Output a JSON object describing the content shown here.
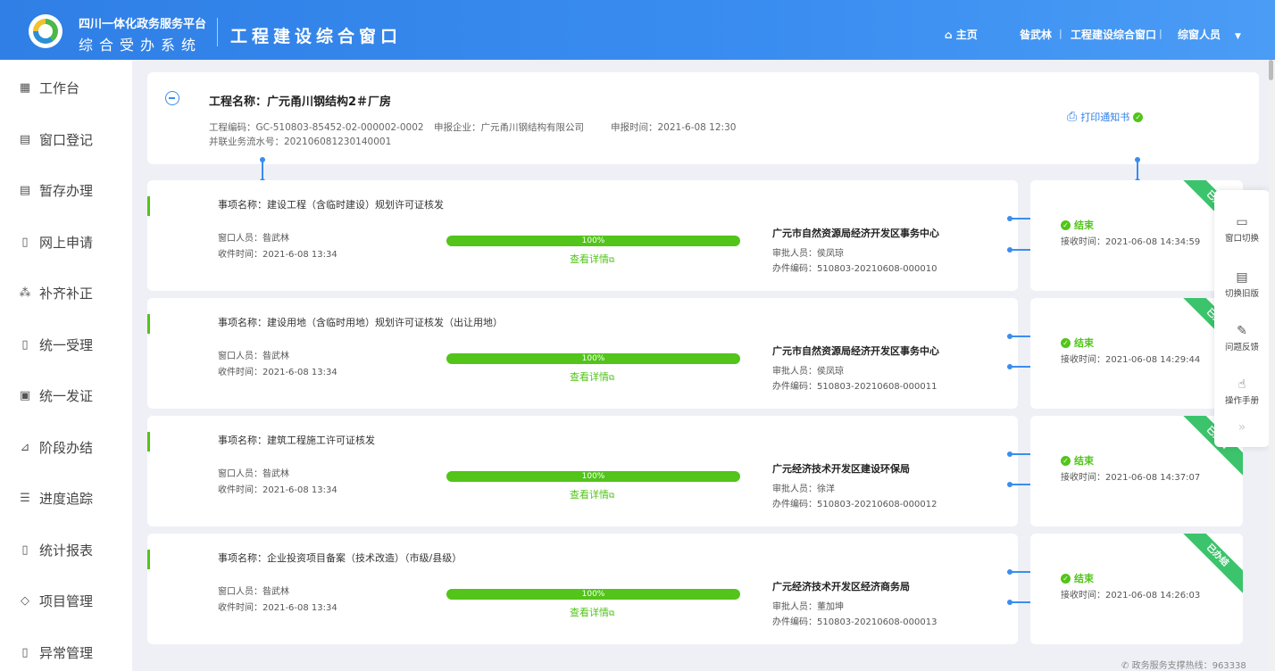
{
  "header": {
    "brand_top": "四川一体化政务服务平台",
    "brand_bottom": "综合受办系统",
    "app_title": "工程建设综合窗口",
    "nav": {
      "home": "主页",
      "user": "昝武林",
      "window": "工程建设综合窗口",
      "role": "综窗人员"
    }
  },
  "sidebar": {
    "items": [
      {
        "label": "工作台",
        "icon": "grid-icon"
      },
      {
        "label": "窗口登记",
        "icon": "document-icon"
      },
      {
        "label": "暂存办理",
        "icon": "document-icon"
      },
      {
        "label": "网上申请",
        "icon": "document-search-icon"
      },
      {
        "label": "补齐补正",
        "icon": "network-icon"
      },
      {
        "label": "统一受理",
        "icon": "document-search-icon"
      },
      {
        "label": "统一发证",
        "icon": "certificate-icon"
      },
      {
        "label": "阶段办结",
        "icon": "chart-line-icon"
      },
      {
        "label": "进度追踪",
        "icon": "list-icon"
      },
      {
        "label": "统计报表",
        "icon": "document-search-icon"
      },
      {
        "label": "项目管理",
        "icon": "shield-icon"
      },
      {
        "label": "异常管理",
        "icon": "document-search-icon"
      }
    ]
  },
  "project": {
    "title": "工程名称：广元甬川钢结构2＃厂房",
    "code": "工程编码：GC-510803-85452-02-000002-0002",
    "company": "申报企业：广元甬川钢结构有限公司",
    "time": "申报时间：2021-6-08 12:30",
    "serial": "并联业务流水号：202106081230140001",
    "print": "打印通知书"
  },
  "tasks": [
    {
      "name": "事项名称：建设工程（含临时建设）规划许可证核发",
      "staff": "窗口人员：昝武林",
      "received": "收件时间：2021-6-08 13:34",
      "progress": "100%",
      "detail": "查看详情",
      "org": "广元市自然资源局经济开发区事务中心",
      "approver": "审批人员：侯凤琼",
      "code": "办件编码：510803-20210608-000010",
      "status": "结束",
      "rtime": "接收时间：2021-06-08 14:34:59",
      "ribbon": "已办结"
    },
    {
      "name": "事项名称：建设用地（含临时用地）规划许可证核发（出让用地）",
      "staff": "窗口人员：昝武林",
      "received": "收件时间：2021-6-08 13:34",
      "progress": "100%",
      "detail": "查看详情",
      "org": "广元市自然资源局经济开发区事务中心",
      "approver": "审批人员：侯凤琼",
      "code": "办件编码：510803-20210608-000011",
      "status": "结束",
      "rtime": "接收时间：2021-06-08 14:29:44",
      "ribbon": "已办结"
    },
    {
      "name": "事项名称：建筑工程施工许可证核发",
      "staff": "窗口人员：昝武林",
      "received": "收件时间：2021-6-08 13:34",
      "progress": "100%",
      "detail": "查看详情",
      "org": "广元经济技术开发区建设环保局",
      "approver": "审批人员：徐洋",
      "code": "办件编码：510803-20210608-000012",
      "status": "结束",
      "rtime": "接收时间：2021-06-08 14:37:07",
      "ribbon": "已办结"
    },
    {
      "name": "事项名称：企业投资项目备案（技术改造）（市级/县级）",
      "staff": "窗口人员：昝武林",
      "received": "收件时间：2021-6-08 13:34",
      "progress": "100%",
      "detail": "查看详情",
      "org": "广元经济技术开发区经济商务局",
      "approver": "审批人员：董加坤",
      "code": "办件编码：510803-20210608-000013",
      "status": "结束",
      "rtime": "接收时间：2021-06-08 14:26:03",
      "ribbon": "已办结"
    }
  ],
  "right_panel": [
    {
      "label": "窗口切换",
      "icon": "window-icon"
    },
    {
      "label": "切换旧版",
      "icon": "old-version-icon"
    },
    {
      "label": "问题反馈",
      "icon": "feedback-icon"
    },
    {
      "label": "操作手册",
      "icon": "hand-pointer-icon"
    }
  ],
  "footer": "政务服务支撑热线：963338",
  "colors": {
    "primary": "#3a8df0",
    "success": "#52c41a",
    "ribbon": "#3cc46c"
  }
}
